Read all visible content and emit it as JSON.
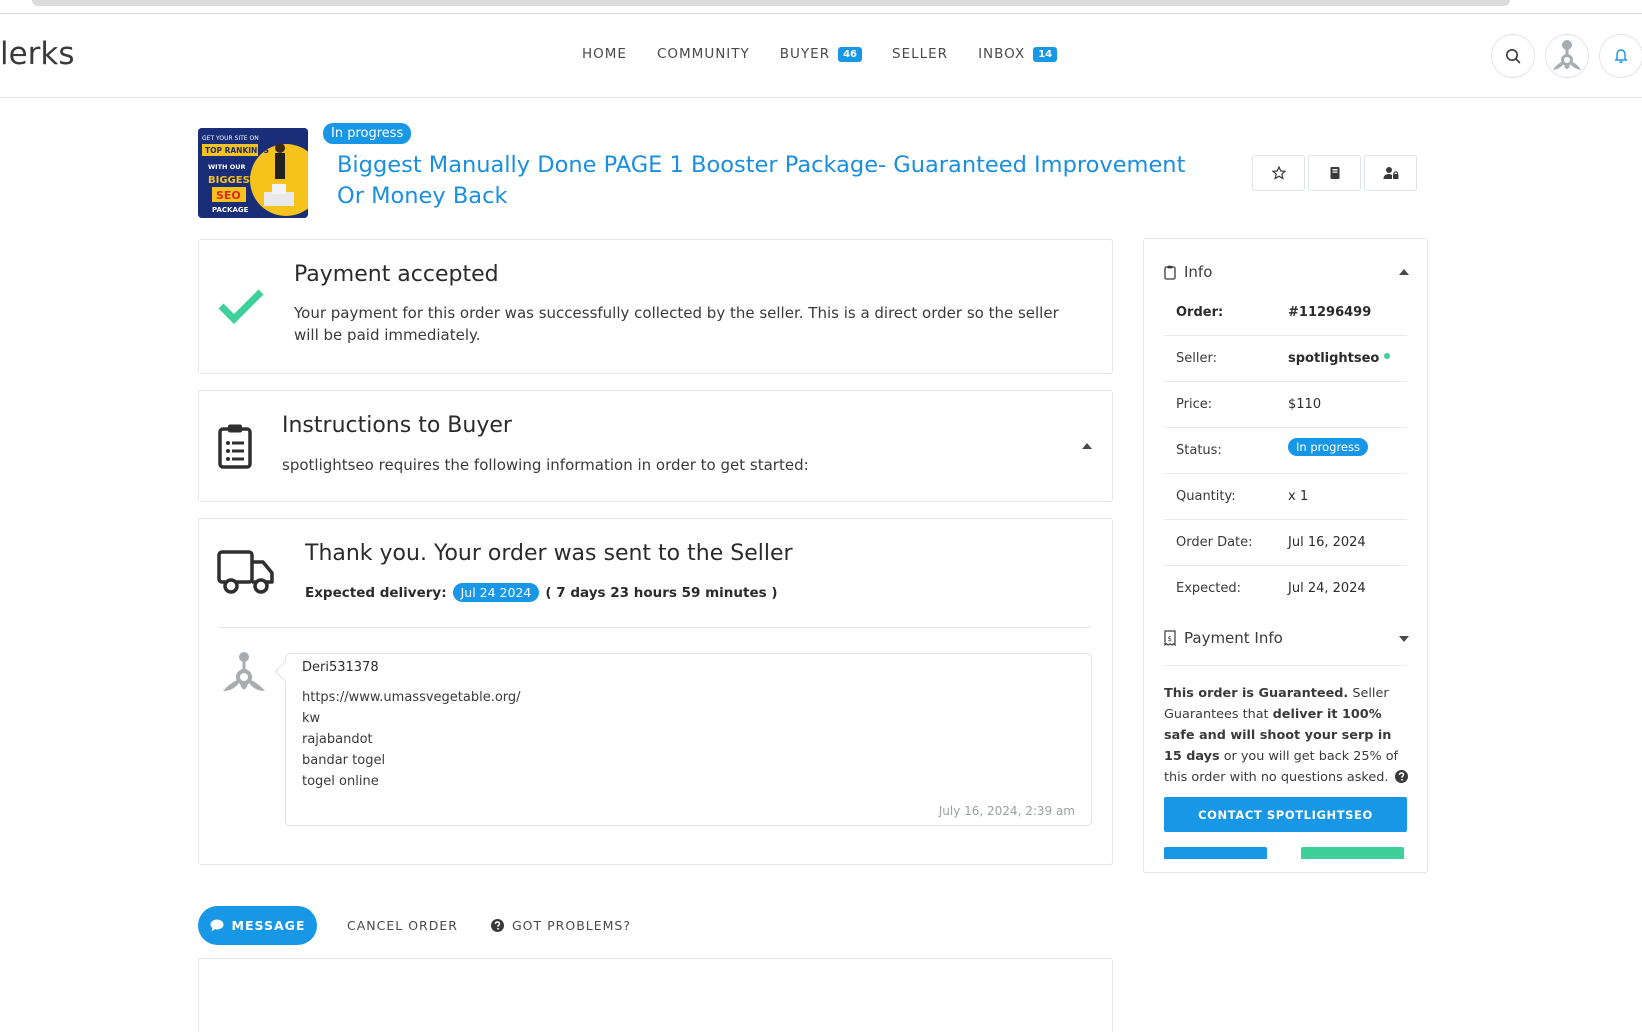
{
  "brand": {
    "logo_text": "lerks"
  },
  "nav": {
    "items": [
      {
        "label": "HOME",
        "badge": ""
      },
      {
        "label": "COMMUNITY",
        "badge": ""
      },
      {
        "label": "BUYER",
        "badge": "46"
      },
      {
        "label": "SELLER",
        "badge": ""
      },
      {
        "label": "INBOX",
        "badge": "14"
      }
    ],
    "icons": [
      "search-icon",
      "avatar",
      "bell-icon"
    ]
  },
  "order_header": {
    "status": "In progress",
    "title": "Biggest Manually Done PAGE 1 Booster Package- Guaranteed Improvement Or Money Back",
    "thumb_text": {
      "line1": "GET YOUR SITE ON",
      "line2": "TOP RANKINGS",
      "line3": "WITH OUR",
      "line4": "BIGGEST",
      "line5": "SEO",
      "line6": "PACKAGE"
    },
    "actions": [
      "star-icon",
      "book-icon",
      "user-lock-icon"
    ]
  },
  "payment_card": {
    "title": "Payment accepted",
    "text": "Your payment for this order was successfully collected by the seller. This is a direct order so the seller will be paid immediately."
  },
  "instructions_card": {
    "title": "Instructions to Buyer",
    "text": "spotlightseo requires the following information in order to get started:"
  },
  "sent_card": {
    "title": "Thank you. Your order was sent to the Seller",
    "delivery_label": "Expected delivery:",
    "delivery_date": "Jul 24 2024",
    "delivery_remaining": "( 7 days 23 hours 59 minutes )"
  },
  "message": {
    "user": "Deri531378",
    "lines": [
      "https://www.umassvegetable.org/",
      "kw",
      "rajabandot",
      "bandar togel",
      "togel online"
    ],
    "time": "July 16, 2024, 2:39 am"
  },
  "sidebar": {
    "info_title": "Info",
    "rows": [
      {
        "key": "Order:",
        "value": "#11296499"
      },
      {
        "key": "Seller:",
        "value": "spotlightseo"
      },
      {
        "key": "Price:",
        "value": "$110"
      },
      {
        "key": "Status:",
        "value": "In progress"
      },
      {
        "key": "Quantity:",
        "value": "x 1"
      },
      {
        "key": "Order Date:",
        "value": "Jul 16, 2024"
      },
      {
        "key": "Expected:",
        "value": "Jul 24, 2024"
      }
    ],
    "payment_title": "Payment Info",
    "guarantee": {
      "b1": "This order is Guaranteed.",
      "t1": " Seller Guarantees that ",
      "b2": "deliver it 100% safe and will shoot your serp in 15 days",
      "t2": " or you will get back 25% of this order with no questions asked."
    },
    "contact_label": "CONTACT SPOTLIGHTSEO"
  },
  "bottom_actions": {
    "message_label": "MESSAGE",
    "cancel_label": "CANCEL ORDER",
    "problems_label": "GOT PROBLEMS?"
  },
  "colors": {
    "accent": "#1897e6",
    "check": "#3ecf9a",
    "link": "#1a8fe0"
  }
}
